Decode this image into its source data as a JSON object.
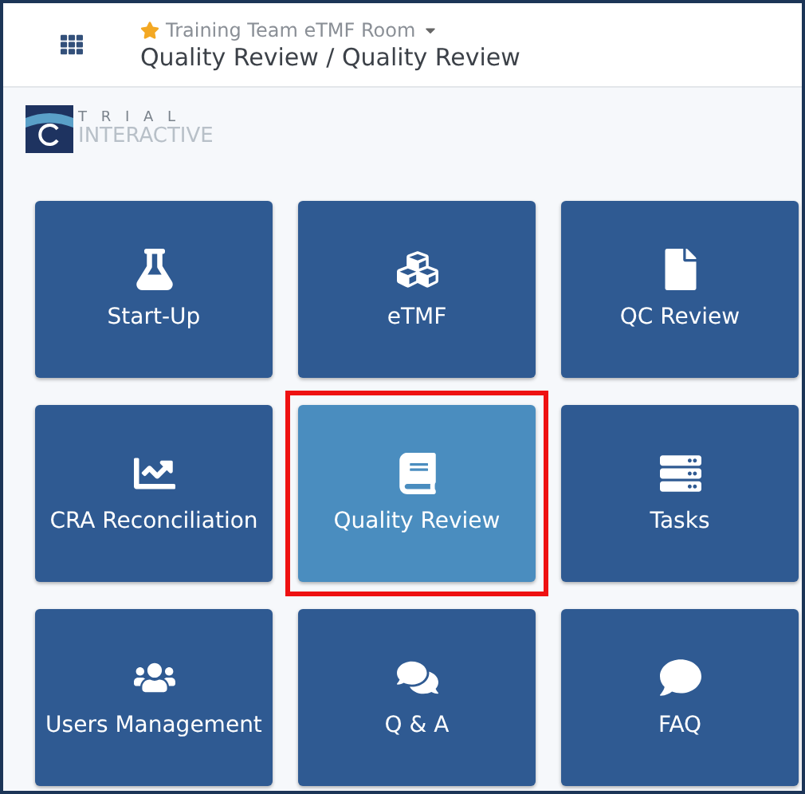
{
  "header": {
    "room": "Training Team eTMF Room",
    "favorite": true,
    "title": "Quality Review / Quality Review"
  },
  "logo": {
    "top": "T R I A L",
    "bottom": "INTERACTIVE"
  },
  "tiles": [
    {
      "label": "Start-Up",
      "selected": false
    },
    {
      "label": "eTMF",
      "selected": false
    },
    {
      "label": "QC Review",
      "selected": false
    },
    {
      "label": "CRA Reconciliation",
      "selected": false
    },
    {
      "label": "Quality Review",
      "selected": true
    },
    {
      "label": "Tasks",
      "selected": false
    },
    {
      "label": "Users Management",
      "selected": false
    },
    {
      "label": "Q & A",
      "selected": false
    },
    {
      "label": "FAQ",
      "selected": false
    }
  ]
}
